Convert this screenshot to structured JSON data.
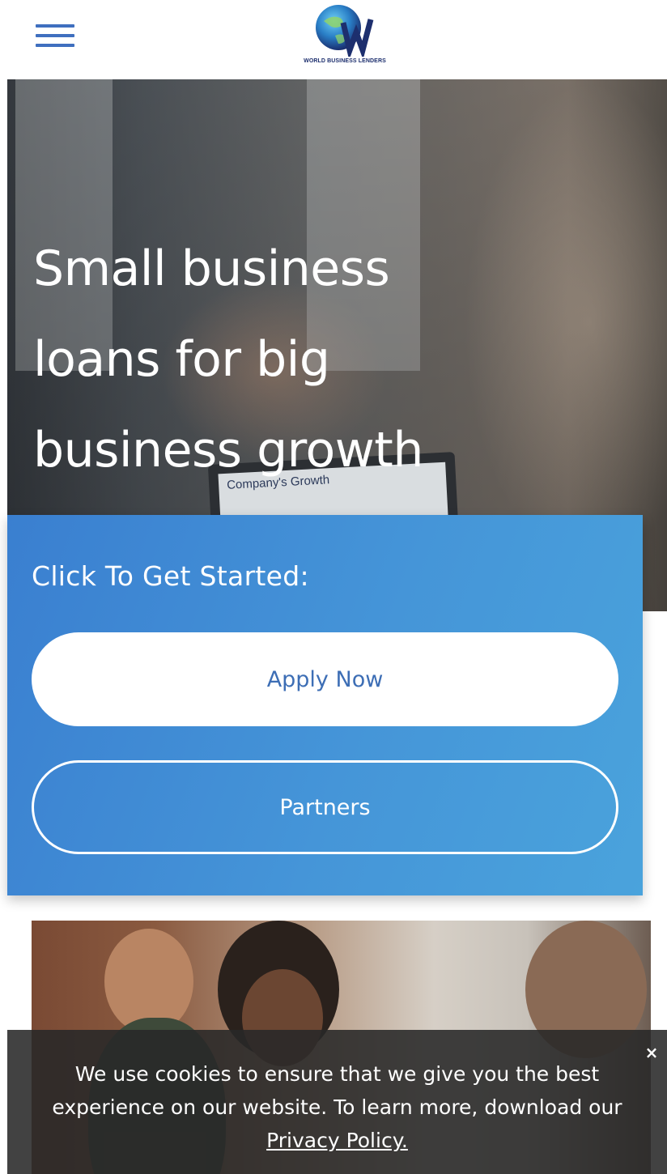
{
  "header": {
    "menu_icon": "hamburger-menu-icon",
    "logo_text": "WORLD BUSINESS LENDERS"
  },
  "hero": {
    "title_lines": [
      "Small business",
      "loans for big",
      "business growth"
    ],
    "laptop_text": "Company's Growth"
  },
  "start_card": {
    "title": "Click To Get Started:",
    "apply_label": "Apply Now",
    "partners_label": "Partners"
  },
  "cookie_bar": {
    "line1": "We use cookies to ensure that we give you the best",
    "line2": "experience on our website. To learn more, download our",
    "link_label": "Privacy Policy.",
    "close_label": "×"
  },
  "colors": {
    "brand_blue": "#3f6fbf",
    "card_gradient_start": "#3a7fd0",
    "card_gradient_end": "#4aa3dc",
    "apply_text": "#3d6eb5",
    "cookie_bg": "#282828"
  }
}
